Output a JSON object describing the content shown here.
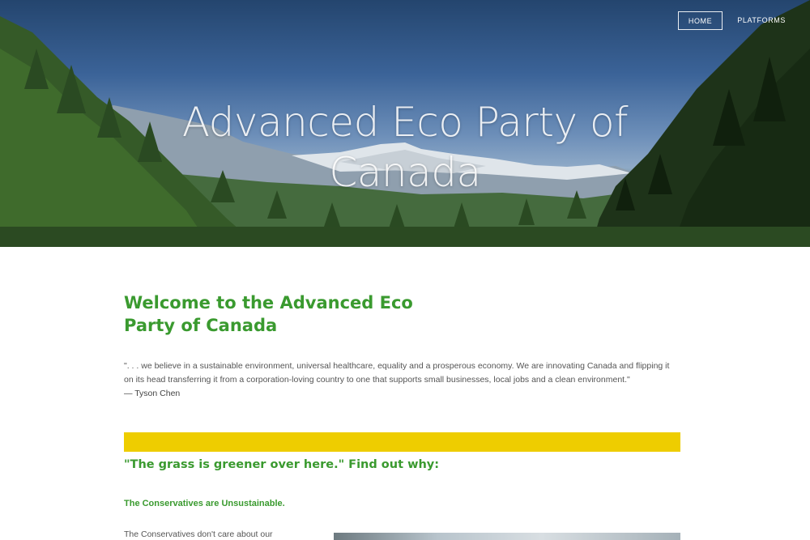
{
  "nav": {
    "items": [
      {
        "label": "HOME",
        "active": true
      },
      {
        "label": "PLATFORMS",
        "active": false
      }
    ]
  },
  "hero": {
    "title": "Advanced Eco Party of Canada",
    "image": "mountain-forest-landscape"
  },
  "intro": {
    "heading": "Welcome to the Advanced Eco Party of Canada",
    "quote": "\". . . we believe in a sustainable environment, universal healthcare, equality and a prosperous economy. We are innovating Canada and flipping it on its head transferring it from a corporation-loving country to one that supports small businesses, local jobs and a clean environment.\"",
    "attribution": "— Tyson Chen"
  },
  "section": {
    "tagline": "\"The grass is greener over here.\" Find out why:",
    "subheading": "The Conservatives are Unsustainable.",
    "body": "The Conservatives don't care about our"
  },
  "colors": {
    "brand_green": "#3a9a2f",
    "accent_yellow": "#eecd00",
    "sky": "#3b6398"
  }
}
